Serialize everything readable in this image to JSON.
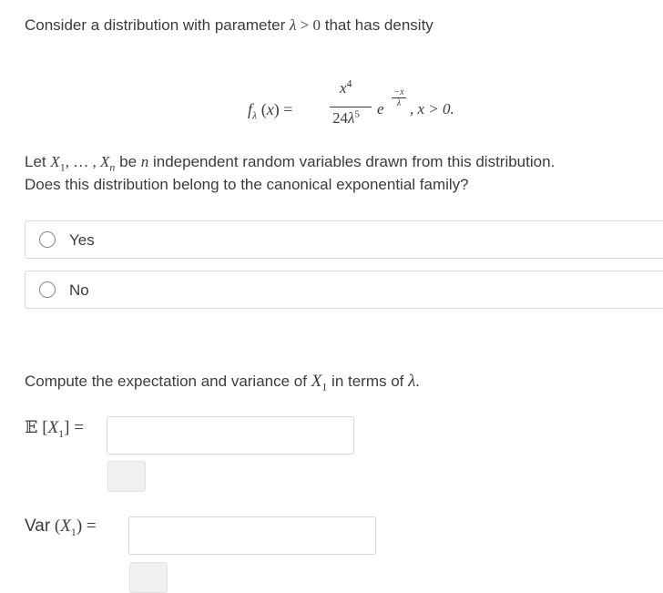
{
  "question1": {
    "intro_prefix": "Consider a distribution with parameter ",
    "intro_suffix": " that has density",
    "density_note": ", x > 0."
  },
  "question2": {
    "line1_prefix": "Let ",
    "line1_suffix": " be ",
    "line1_rest": " independent random variables drawn from this distribution.",
    "line2": "Does this distribution belong to the canonical exponential family?",
    "options": [
      {
        "label": "Yes"
      },
      {
        "label": "No"
      }
    ]
  },
  "question3": {
    "prompt_prefix": "Compute the expectation and variance of ",
    "prompt_middle": " in terms of ",
    "expectation_value": "",
    "variance_value": ""
  }
}
